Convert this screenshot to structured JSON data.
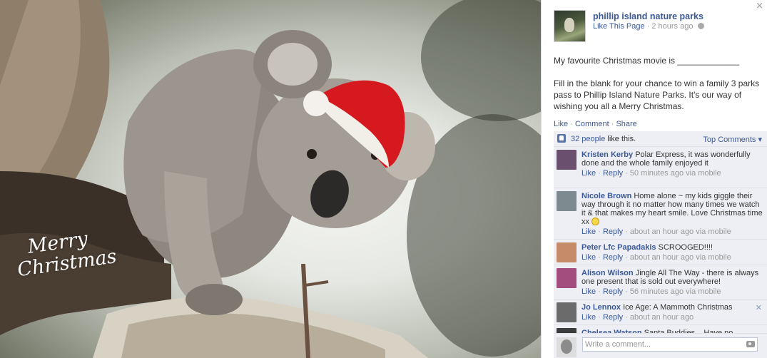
{
  "photo": {
    "caption_line1": "Merry",
    "caption_line2": "Christmas"
  },
  "panel": {
    "close_glyph": "×",
    "page_name": "phillip island nature parks",
    "like_page": "Like This Page",
    "timestamp": "2 hours ago",
    "privacy_icon": "globe-icon",
    "post_line1": "My favourite Christmas movie is _____________",
    "post_line2": "Fill in the blank for your chance to win a family 3 parks pass to Phillip Island Nature Parks. It's our way of wishing you all a Merry Christmas.",
    "actions": {
      "like": "Like",
      "comment": "Comment",
      "share": "Share"
    },
    "likes": {
      "count_text": "32 people",
      "suffix": "like this.",
      "top_comments": "Top Comments"
    },
    "comments": [
      {
        "author": "Kristen Kerby",
        "text": "Polar Express, it was wonderfully done and the whole family enjoyed it",
        "like": "Like",
        "reply": "Reply",
        "meta": "50 minutes ago via mobile",
        "avatar_color": "#6a4f6e"
      },
      {
        "author": "Nicole Brown",
        "text": "Home alone ~ my kids giggle their way through it no matter how many times we watch it & that makes my heart smile. Love Christmas time xx",
        "like": "Like",
        "reply": "Reply",
        "meta": "about an hour ago via mobile",
        "avatar_color": "#7d8a8f"
      },
      {
        "author": "Peter Lfc Papadakis",
        "text": "SCROOGED!!!!",
        "like": "Like",
        "reply": "Reply",
        "meta": "about an hour ago via mobile",
        "avatar_color": "#c58c6a"
      },
      {
        "author": "Alison Wilson",
        "text": "Jingle All The Way - there is always one present that is sold out everywhere!",
        "like": "Like",
        "reply": "Reply",
        "meta": "56 minutes ago via mobile",
        "avatar_color": "#a24d7e"
      },
      {
        "author": "Jo Lennox",
        "text": "Ice Age: A Mammoth Christmas",
        "like": "Like",
        "reply": "Reply",
        "meta": "about an hour ago",
        "avatar_color": "#6b6b6b"
      },
      {
        "author": "Chelsea Watson",
        "text": "Santa Buddies... Have no",
        "like": "",
        "reply": "",
        "meta": "",
        "avatar_color": "#3c3c3c"
      }
    ],
    "remove_glyph": "✕",
    "compose_placeholder": "Write a comment...",
    "colors": {
      "link": "#3b5998",
      "ufi_bg": "#edeff4",
      "meta": "#999999"
    }
  }
}
